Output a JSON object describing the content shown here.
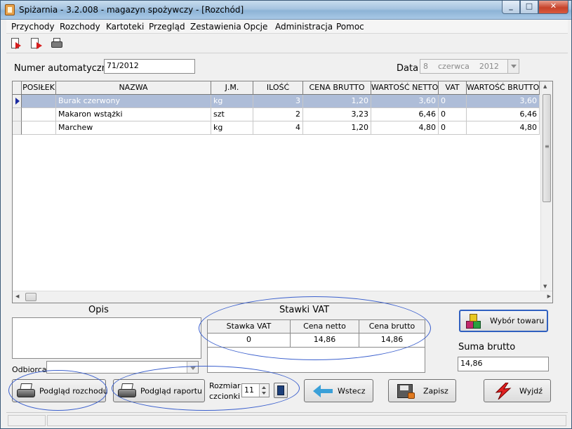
{
  "window": {
    "title": "Spiżarnia - 3.2.008 - magazyn spożywczy - [Rozchód]",
    "controls": {
      "minimize": "_",
      "maximize": "□",
      "close": "✕"
    }
  },
  "menu": [
    "Przychody",
    "Rozchody",
    "Kartoteki",
    "Przegląd",
    "Zestawienia",
    "Opcje",
    "Administracja",
    "Pomoc"
  ],
  "toolbar": {
    "icons": [
      "new-document-icon",
      "export-document-icon",
      "print-icon"
    ]
  },
  "header": {
    "number_label": "Numer automatyczny",
    "number_value": "71/2012",
    "date_label": "Data",
    "date_day": "8",
    "date_month": "czerwca",
    "date_year": "2012"
  },
  "grid": {
    "columns": [
      "POSIŁEK",
      "NAZWA",
      "J.M.",
      "ILOŚĆ",
      "CENA BRUTTO",
      "WARTOŚĆ NETTO",
      "VAT",
      "WARTOŚĆ BRUTTO"
    ],
    "rows": [
      {
        "posilek": "",
        "nazwa": "Burak czerwony",
        "jm": "kg",
        "ilosc": "3",
        "cena_brutto": "1,20",
        "wartosc_netto": "3,60",
        "vat": "0",
        "wartosc_brutto": "3,60",
        "selected": true
      },
      {
        "posilek": "",
        "nazwa": "Makaron wstążki",
        "jm": "szt",
        "ilosc": "2",
        "cena_brutto": "3,23",
        "wartosc_netto": "6,46",
        "vat": "0",
        "wartosc_brutto": "6,46",
        "selected": false
      },
      {
        "posilek": "",
        "nazwa": "Marchew",
        "jm": "kg",
        "ilosc": "4",
        "cena_brutto": "1,20",
        "wartosc_netto": "4,80",
        "vat": "0",
        "wartosc_brutto": "4,80",
        "selected": false
      }
    ],
    "scroll_arrows": {
      "up": "▲",
      "down": "▼",
      "left": "◀",
      "right": "▶",
      "grip": "≡"
    }
  },
  "opis": {
    "title": "Opis",
    "value": ""
  },
  "odbiorca": {
    "label": "Odbiorca",
    "value": ""
  },
  "vat": {
    "title": "Stawki VAT",
    "columns": [
      "Stawka VAT",
      "Cena netto",
      "Cena brutto"
    ],
    "row": [
      "0",
      "14,86",
      "14,86"
    ]
  },
  "buttons": {
    "wybor_towaru": "Wybór towaru",
    "podglad_rozchodu": "Podgląd rozchodu",
    "podglad_raportu": "Podgląd raportu",
    "wstecz": "Wstecz",
    "zapisz": "Zapisz",
    "wyjdz": "Wyjdź"
  },
  "font_size": {
    "label_line1": "Rozmiar",
    "label_line2": "czcionki",
    "value": "11"
  },
  "suma": {
    "label": "Suma brutto",
    "value": "14,86"
  },
  "colors": {
    "selection": "#aebdd8",
    "highlight_ellipse": "#3a5fcd",
    "wybor_button_border": "#3060c0"
  }
}
